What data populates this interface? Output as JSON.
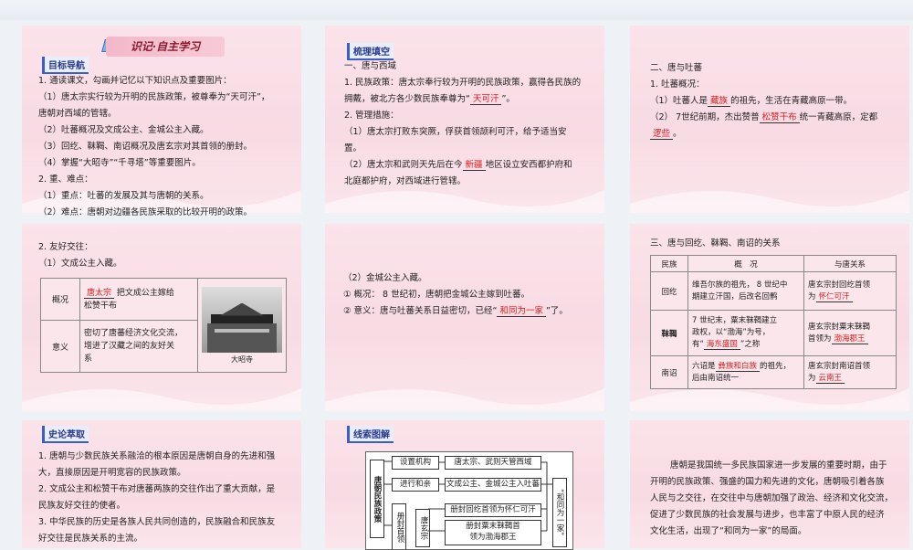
{
  "s1": {
    "banner": "识记·自主学习",
    "tag": "目标导航",
    "lines": [
      "1. 通读课文，勾画并记忆以下知识点及重要图片：",
      "（1）唐太宗实行较为开明的民族政策，被尊奉为“天可汗”，",
      "唐朝对西域的管辖。",
      "（2）吐蕃概况及文成公主、金城公主入藏。",
      "（3）回纥、靺鞨、南诏概况及唐玄宗对其首领的册封。",
      "（4）掌握“大昭寺”“千寻塔”等重要图片。",
      "2. 重、难点：",
      "（1）重点：吐蕃的发展及其与唐朝的关系。",
      "（2）难点：唐朝对边疆各民族采取的比较开明的政策。"
    ]
  },
  "s2": {
    "tag": "梳理填空",
    "h1": "一、唐与西域",
    "l1a": "1. 民族政策：唐太宗奉行较为开明的民族政策，赢得各民族的",
    "l1b": "拥戴，被北方各少数民族奉尊为“",
    "fill1": "天可汗",
    "l1c": "”。",
    "l2": "2. 管理措施：",
    "l3a": "（1）唐太宗打败东突厥，俘获首领颉利可汗，给予适当安",
    "l3b": "置。",
    "l4a": "（2）唐太宗和武则天先后在今",
    "fill2": "新疆",
    "l4b": "地区设立安西都护府和",
    "l4c": "北庭都护府，对西域进行管辖。"
  },
  "s3": {
    "h": "二、唐与吐蕃",
    "l1": "1. 吐蕃概况：",
    "l2a": "（1）吐蕃人是",
    "fill1": "藏族",
    "l2b": "的祖先，生活在青藏高原一带。",
    "l3a": "（2） 7世纪前期，杰出赞普",
    "fill2": "松赞干布",
    "l3b": "统一青藏高原，定都",
    "fill3": "逻些",
    "l3c": "。"
  },
  "s4": {
    "l1": "2. 友好交往：",
    "l2": "（1）文成公主入藏。",
    "r1h": "概况",
    "r1fill": "唐太宗",
    "r1a": "把文成公主嫁给",
    "r1b": "松赞干布",
    "r2h": "意义",
    "r2a": "密切了唐蕃经济文化交流，",
    "r2b": "增进了汉藏之间的友好关",
    "r2c": "系",
    "caption": "大昭寺"
  },
  "s5": {
    "l1": "（2）金城公主入藏。",
    "l2": "① 概况： 8 世纪初，唐朝把金城公主嫁到吐蕃。",
    "l3a": "② 意义：唐与吐蕃关系日益密切，已经“",
    "fill": "和同为一家",
    "l3b": "”了。"
  },
  "s6": {
    "h": "三、唐与回纥、靺鞨、南诏的关系",
    "headers": [
      "民族",
      "概　况",
      "与唐关系"
    ],
    "rows": [
      {
        "name": "回纥",
        "desc": [
          "维吾尔族的祖先， 8 世纪中",
          "期建立汗国，后改名回鹘"
        ],
        "rel": "唐玄宗封回纥首领",
        "relb": "为",
        "fill": "怀仁可汗",
        "bold": false
      },
      {
        "name": "靺鞨",
        "desc": [
          "7 世纪末，粟末靺鞨建立",
          "政权，以“渤海”为号，",
          "有“"
        ],
        "descfill": "海东盛国",
        "desc_tail": "”之称",
        "rel": "唐玄宗封粟末靺鞨",
        "relb": "首领为",
        "fill": "渤海郡王",
        "bold": true
      },
      {
        "name": "南诏",
        "desc": [
          "六诏是",
          "后由南诏统一"
        ],
        "descfill": "彝族和白族",
        "desc_tail": "的祖先，",
        "rel": "唐玄宗封南诏首领",
        "relb": "为",
        "fill": "云南王",
        "bold": false
      }
    ]
  },
  "s7": {
    "tag": "史论萃取",
    "lines": [
      "1. 唐朝与少数民族关系融洽的根本原因是唐朝自身的先进和强",
      "大，直接原因是开明宽容的民族政策。",
      "2. 文成公主和松赞干布对唐蕃两族的交往作出了重大贡献，是",
      "民族友好交往的使者。",
      "3. 中华民族的历史是各族人民共同创造的，民族融合和民族友",
      "好交往是民族关系的主流。"
    ]
  },
  "s8": {
    "tag": "线索图解",
    "left": "唐朝民族政策",
    "b1": "设置机构",
    "b2": "进行和亲",
    "b3": "册封首领",
    "b4": "唐玄宗",
    "c1": "唐太宗、武则天管西域",
    "c2": "文成公主、金城公主入吐蕃",
    "c3": "册封回纥首领为怀仁可汗",
    "c4a": "册封粟末靺鞨首",
    "c4b": "领为渤海郡王",
    "right": "“和同为一家”"
  },
  "s9": {
    "lines": [
      "唐朝是我国统一多民族国家进一步发展的重要时期，由于",
      "开明的民族政策、强盛的国力和先进的文化，唐朝吸引着各族",
      "人民与之交往，在交往中与唐朝加强了政治、经济和文化交流，",
      "促进了少数民族的社会发展与进步，也丰富了中原人民的经济",
      "文化生活，出现了“和同为一家”的局面。"
    ]
  },
  "colors": {
    "fill": "#d91c1c",
    "slide": "#f8dbe4",
    "tag": "#2a3a8c"
  }
}
